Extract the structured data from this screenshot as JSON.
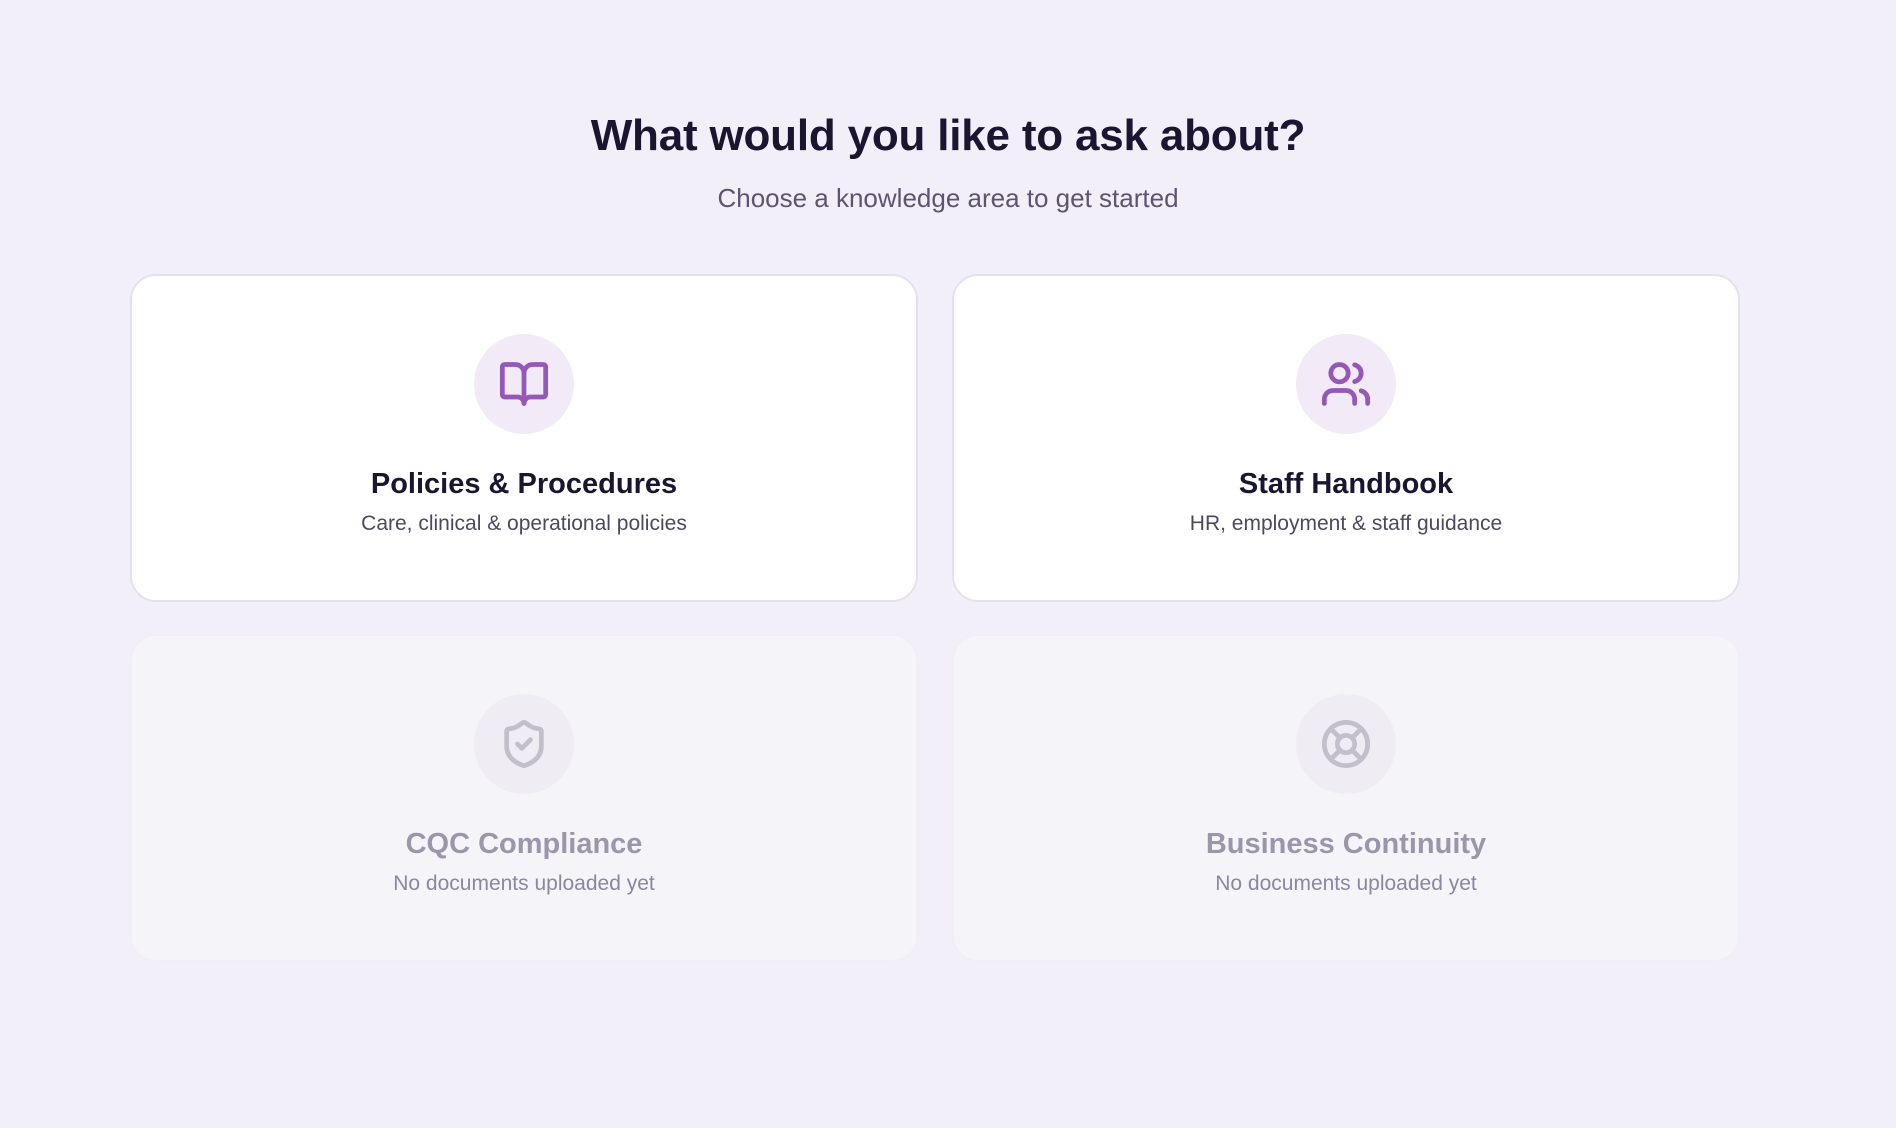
{
  "header": {
    "title": "What would you like to ask about?",
    "subtitle": "Choose a knowledge area to get started"
  },
  "colors": {
    "background": "#f2eff9",
    "accent": "#9558b8",
    "icon_circle": "#f3eaf8",
    "disabled_icon": "#c2bfca"
  },
  "cards": [
    {
      "icon": "book-open-icon",
      "title": "Policies & Procedures",
      "description": "Care, clinical & operational policies",
      "enabled": true
    },
    {
      "icon": "users-icon",
      "title": "Staff Handbook",
      "description": "HR, employment & staff guidance",
      "enabled": true
    },
    {
      "icon": "shield-check-icon",
      "title": "CQC Compliance",
      "description": "No documents uploaded yet",
      "enabled": false
    },
    {
      "icon": "life-buoy-icon",
      "title": "Business Continuity",
      "description": "No documents uploaded yet",
      "enabled": false
    }
  ]
}
